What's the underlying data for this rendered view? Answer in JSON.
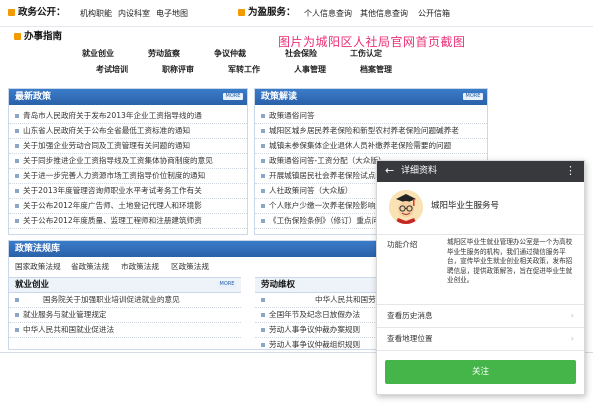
{
  "colors": {
    "brand_blue": "#2a61a8",
    "orange": "#f29b00",
    "caption_pink": "#ec2f76",
    "follow_green": "#46b549",
    "phone_bar": "#38393d"
  },
  "topbar": {
    "gov_title": "政务公开：",
    "gov_links": [
      "机构职能",
      "内设科室",
      "电子地图"
    ],
    "service_title": "为盈服务：",
    "service_links": [
      "个人信息查询",
      "其他信息查询",
      "公开信箱"
    ]
  },
  "guide": {
    "title": "办事指南",
    "row1": [
      "就业创业",
      "劳动监察",
      "争议仲裁",
      "社会保险",
      "工伤认定"
    ],
    "row2": [
      "考试培训",
      "职称评审",
      "军转工作",
      "人事管理",
      "档案管理"
    ]
  },
  "caption": "图片为城阳区人社局官网首页截图",
  "latest_policy": {
    "title": "最新政策",
    "more": "MORE",
    "items": [
      "青岛市人民政府关于发布2013年企业工资指导线的通",
      "山东省人民政府关于公布全省最低工资标准的通知",
      "关于加强企业劳动合同及工资管理有关问题的通知",
      "关于同步推进企业工资指导线及工资集体协商制度的意见",
      "关于进一步完善人力资源市场工资指导价位制度的通知",
      "关于2013年度管理咨询师职业水平考试考务工作有关",
      "关于公布2012年度广告师、土地登记代理人和环境影",
      "关于公布2012年度质量、监理工程师和注册建筑师资"
    ]
  },
  "interpretation": {
    "title": "政策解读",
    "more": "MORE",
    "items": [
      "政策通俗问答",
      "城阳区城乡居民养老保险和新型农村养老保险问题碱养老",
      "城镇未参保集体企业退休人员补缴养老保险需要的问题",
      "政策通俗问答-工资分配（大众版）",
      "开展城镇居民社会养老保险试点的有关问题",
      "人社政策问答（大众版）",
      "个人账户少缴一次养老保险影响退休吗？",
      "《工伤保险条例》（修订）重点问题解读"
    ]
  },
  "laws": {
    "title": "政策法规库",
    "tabs": [
      "国家政策法规",
      "省政策法规",
      "市政策法规",
      "区政策法规"
    ],
    "employment": {
      "title": "就业创业",
      "more": "MORE",
      "items": [
        "国务院关于加强职业培训促进就业的意见",
        "就业服务与就业管理规定",
        "中华人民共和国就业促进法"
      ]
    },
    "labor": {
      "title": "劳动维权",
      "items": [
        "中华人民共和国劳动...",
        "全国年节及纪念日放假办法",
        "劳动人事争议仲裁办案规则",
        "劳动人事争议仲裁组织规则"
      ]
    }
  },
  "phone": {
    "header_title": "详细资料",
    "account_name": "城阳毕业生服务号",
    "intro_label": "功能介绍",
    "intro_text": "城阳区毕业生就业管理办公室是一个为高校毕业生服务的机构，我们通过微信服务平台，宣传毕业生就业创业相关政策，发布招聘信息，提供政策解答，旨在促进毕业生就业创业。",
    "history_link": "查看历史消息",
    "location_link": "查看地理位置",
    "follow_button": "关注"
  }
}
